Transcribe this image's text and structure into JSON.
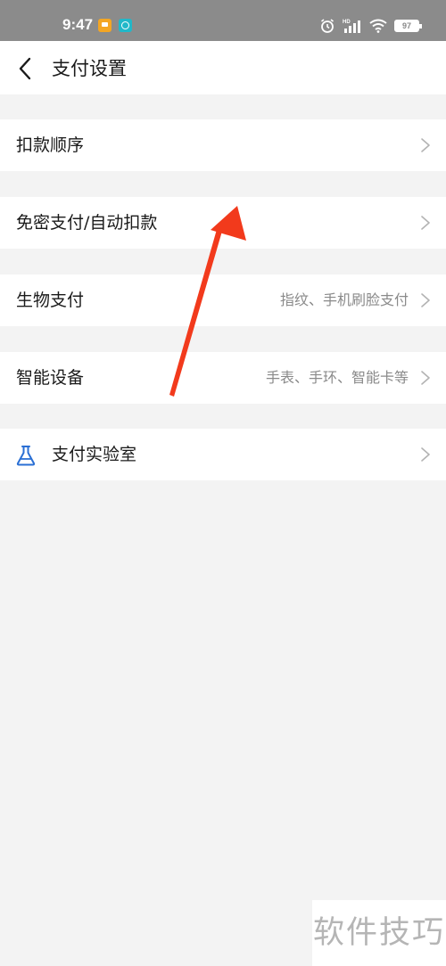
{
  "status_bar": {
    "time": "9:47",
    "battery": "97",
    "icons": [
      "notes-app-icon",
      "browser-app-icon",
      "alarm-icon",
      "hd-signal-icon",
      "wifi-icon",
      "battery-icon"
    ]
  },
  "header": {
    "title": "支付设置",
    "back_icon": "chevron-left-icon"
  },
  "settings": {
    "items": [
      {
        "label": "扣款顺序",
        "sub": ""
      },
      {
        "label": "免密支付/自动扣款",
        "sub": ""
      },
      {
        "label": "生物支付",
        "sub": "指纹、手机刷脸支付"
      },
      {
        "label": "智能设备",
        "sub": "手表、手环、智能卡等"
      },
      {
        "label": "支付实验室",
        "sub": "",
        "icon": "flask-icon"
      }
    ]
  },
  "annotation": {
    "arrow_color": "#f23a1c"
  },
  "watermark": {
    "text": "软件技巧"
  },
  "colors": {
    "status_bar": "#8b8b8b",
    "background": "#f3f3f3",
    "row_bg": "#ffffff",
    "text_primary": "#1a1a1a",
    "text_secondary": "#8a8a8a",
    "lab_icon": "#2a6fd4"
  }
}
